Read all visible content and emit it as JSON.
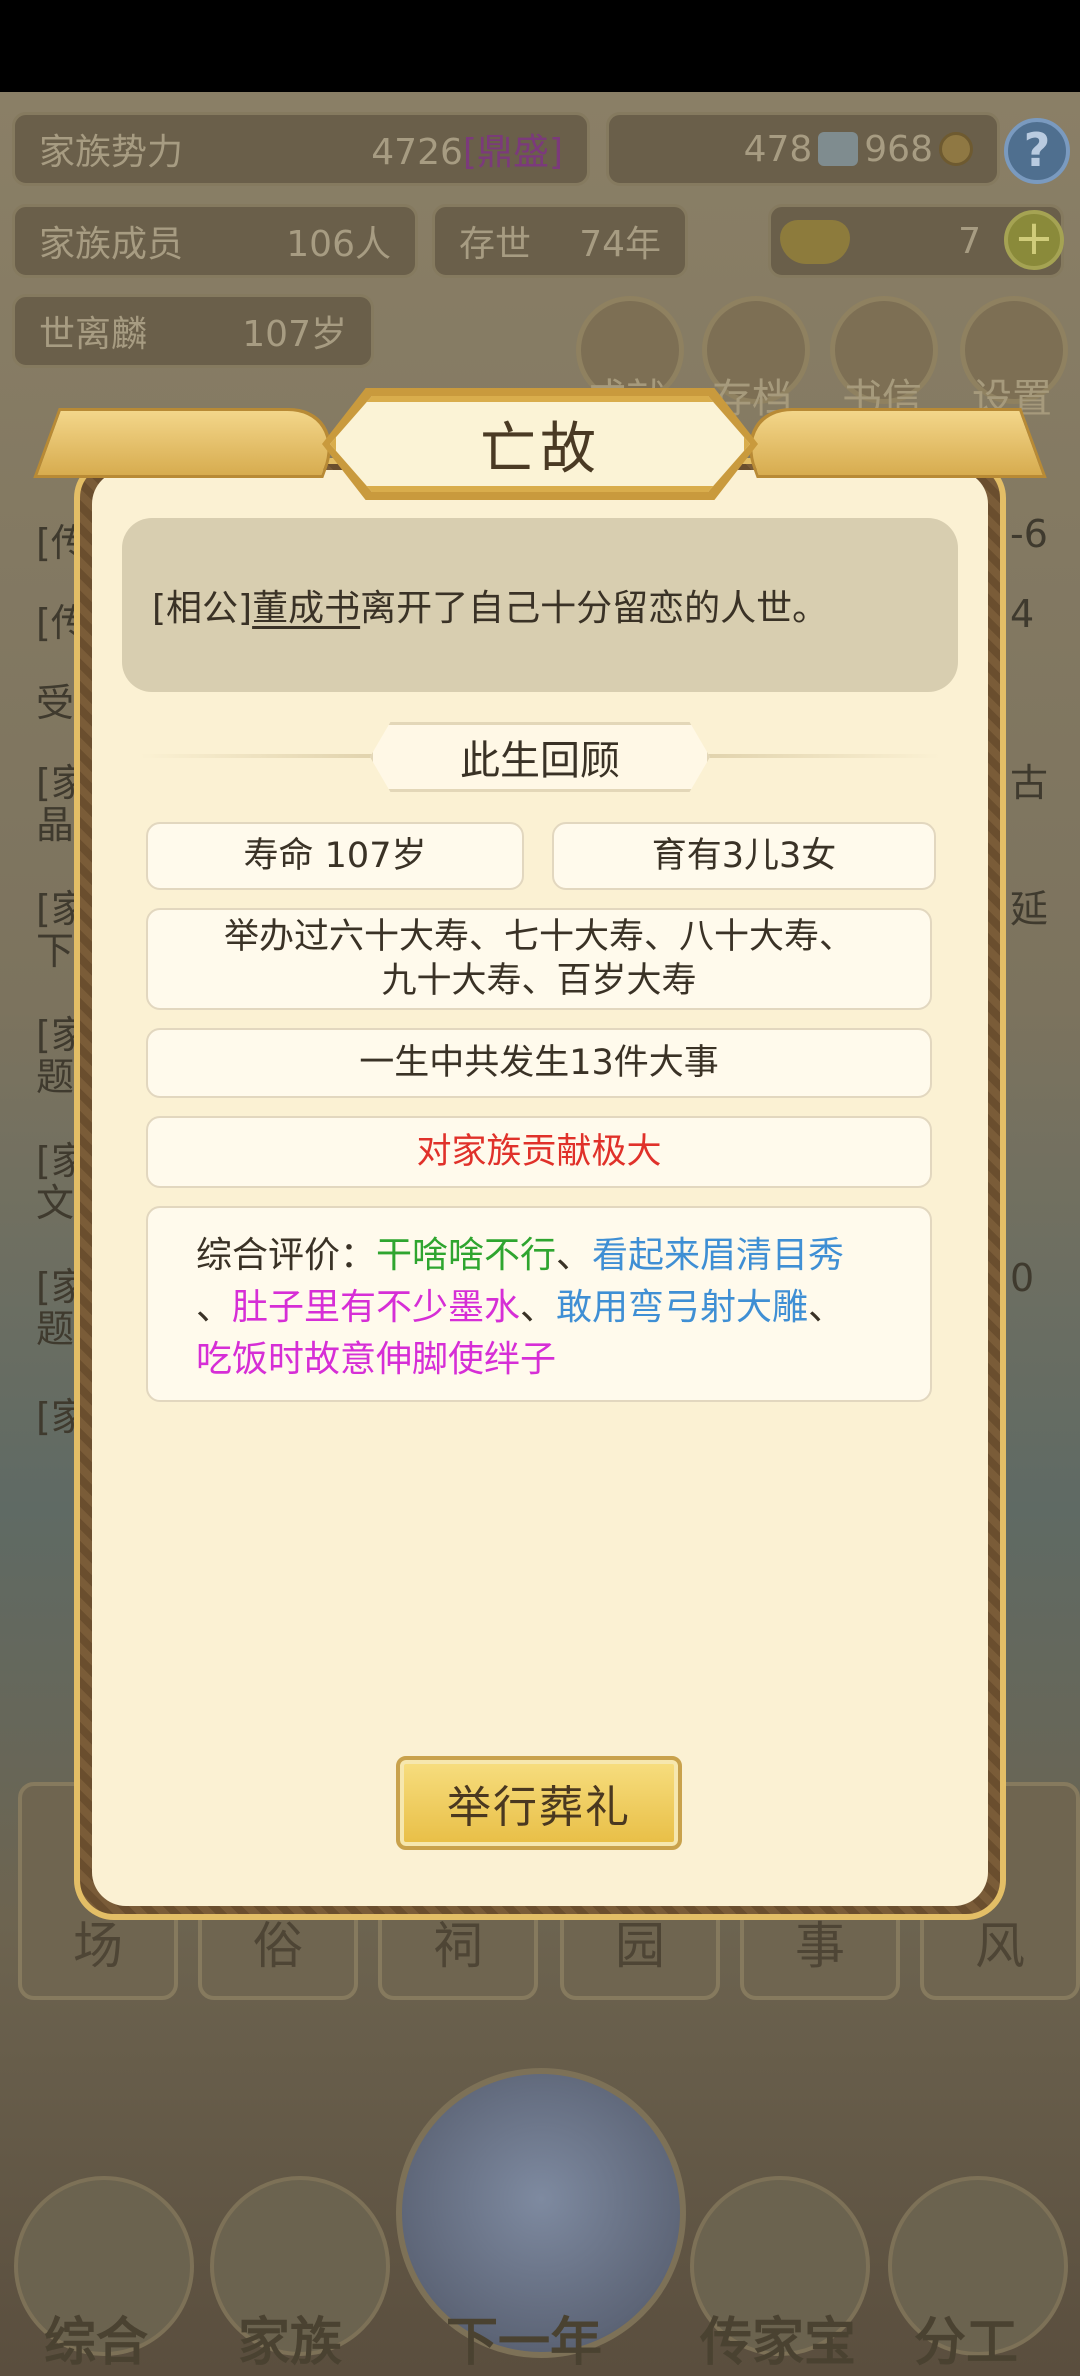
{
  "background": {
    "family_power_label": "家族势力",
    "family_power_value": "4726",
    "family_power_tag": "[鼎盛]",
    "res_a": "478",
    "res_b": "968",
    "members_label": "家族成员",
    "members_value": "106人",
    "exist_label": "存世",
    "exist_value": "74年",
    "gold_value": "7",
    "elder_name": "世离麟",
    "elder_age": "107岁",
    "menu_buttons": [
      "成就",
      "存档",
      "书信",
      "设置"
    ],
    "list_rows": [
      "[传",
      "[传",
      "受",
      "[家",
      "晶",
      "[家",
      "下",
      "[家",
      "题",
      "[家",
      "文",
      "[家",
      "题",
      "[家"
    ],
    "right_nums": [
      "-6",
      "4",
      "古",
      "延",
      "0"
    ],
    "bottom_cards": [
      "场",
      "俗",
      "祠",
      "园",
      "事",
      "风"
    ],
    "bottom_nav": [
      "综合",
      "家族",
      "下一年",
      "传家宝",
      "分工"
    ]
  },
  "dialog": {
    "title": "亡故",
    "message": {
      "prefix": "[相公]",
      "name": "董成书",
      "suffix": "离开了自己十分留恋的人世。"
    },
    "section_title": "此生回顾",
    "lifespan": "寿命 107岁",
    "children": "育有3儿3女",
    "birthdays_line1": "举办过六十大寿、七十大寿、八十大寿、",
    "birthdays_line2": "九十大寿、百岁大寿",
    "events": "一生中共发生13件大事",
    "contribution": "对家族贡献极大",
    "evaluation": {
      "label": "综合评价：",
      "sep": "、",
      "traits": [
        {
          "text": "干啥啥不行",
          "color": "#2fa52f"
        },
        {
          "text": "看起来眉清目秀",
          "color": "#3f8fd4"
        },
        {
          "text": "肚子里有不少墨水",
          "color": "#d62ed6"
        },
        {
          "text": "敢用弯弓射大雕",
          "color": "#3f8fd4"
        },
        {
          "text": "吃饭时故意伸脚使绊子",
          "color": "#d62ed6"
        }
      ]
    },
    "funeral_button": "举行葬礼"
  },
  "colors": {
    "contribution": "#e0312a",
    "accent_gold": "#e8be45"
  }
}
